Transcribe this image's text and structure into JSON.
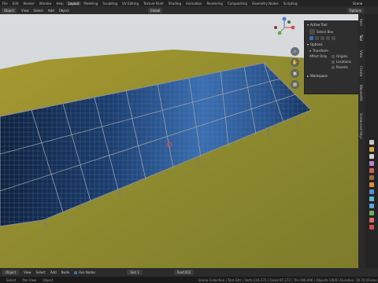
{
  "topbar": {
    "workspaces": [
      "File",
      "Edit",
      "Render",
      "Window",
      "Help",
      "Layout",
      "Modeling",
      "Sculpting",
      "UV Editing",
      "Texture Paint",
      "Shading",
      "Animation",
      "Rendering",
      "Compositing",
      "Geometry Nodes",
      "Scripting"
    ],
    "active_workspace": "Layout",
    "scene_label": "Scene"
  },
  "header": {
    "mode": "Object",
    "menus": [
      "View",
      "Select",
      "Add",
      "Object"
    ],
    "orientation": "Global",
    "options_label": "Options"
  },
  "npanel": {
    "active_tool_title": "Active Tool",
    "tool_name": "Select Box",
    "options_title": "Options",
    "transform_title": "Transform",
    "affect_only_label": "Affect Only",
    "affect_only_items": [
      "Origins",
      "Locations",
      "Parents"
    ],
    "workspace_title": "Workspace"
  },
  "tabs": [
    "Item",
    "Tool",
    "View",
    "Create",
    "BlenderKit",
    "Screencast Keys"
  ],
  "bottom": {
    "mode": "Object",
    "menus": [
      "View",
      "Select",
      "Add",
      "Node"
    ],
    "use_nodes": "Use Nodes",
    "slot": "Slot 1",
    "material": "Roof.002"
  },
  "status": {
    "left_items": [
      "Select",
      "Pan View",
      "Object"
    ],
    "stats": "Scene Collection | Tent Gtrr | Verts:114,272 | Faces:97,272 | Tris:196,096 | Objects:1/6/8 | Duration: 30:70 (Frame"
  },
  "colors": {
    "ground": "#9a9030",
    "panel": "#1c4f8c",
    "frame": "#8d8d8d",
    "sky": "#cfd3d6"
  }
}
